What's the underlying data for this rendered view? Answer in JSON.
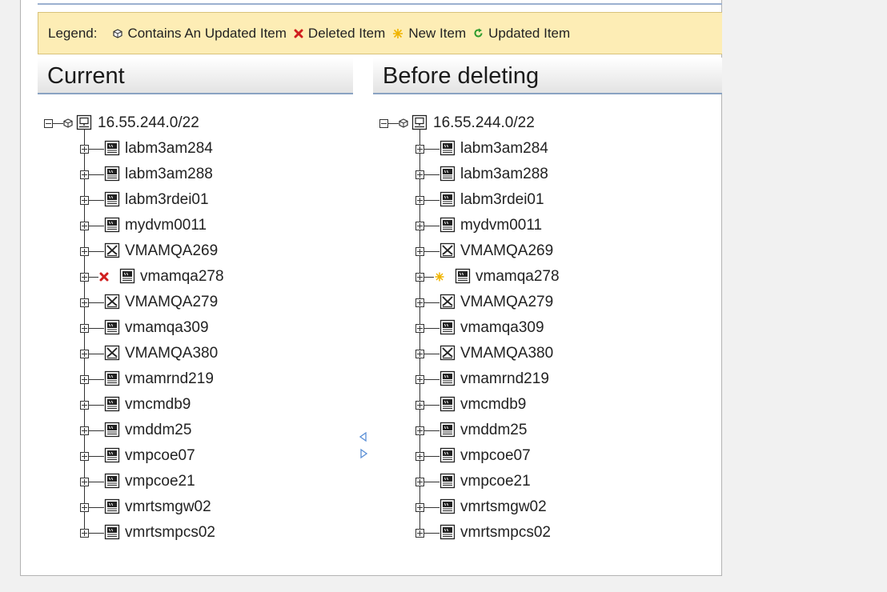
{
  "legend": {
    "title": "Legend:",
    "items": [
      {
        "label": "Contains An Updated Item",
        "icon": "contains-updated-icon"
      },
      {
        "label": "Deleted Item",
        "icon": "deleted-icon",
        "color": "#d01f1f"
      },
      {
        "label": "New Item",
        "icon": "new-icon",
        "color": "#f0b400"
      },
      {
        "label": "Updated Item",
        "icon": "updated-icon",
        "color": "#2e9b2e"
      }
    ]
  },
  "panes": {
    "left": {
      "title": "Current",
      "root": {
        "label": "16.55.244.0/22",
        "icon": "network-icon",
        "marker": "contains-updated"
      },
      "items": [
        {
          "label": "labm3am284",
          "icon": "server-icon",
          "marker": ""
        },
        {
          "label": "labm3am288",
          "icon": "server-icon",
          "marker": ""
        },
        {
          "label": "labm3rdei01",
          "icon": "server-icon",
          "marker": ""
        },
        {
          "label": "mydvm0011",
          "icon": "server-icon",
          "marker": ""
        },
        {
          "label": "VMAMQA269",
          "icon": "vmware-host-icon",
          "marker": ""
        },
        {
          "label": "vmamqa278",
          "icon": "server-icon",
          "marker": "deleted"
        },
        {
          "label": "VMAMQA279",
          "icon": "vmware-host-icon",
          "marker": ""
        },
        {
          "label": "vmamqa309",
          "icon": "server-icon",
          "marker": ""
        },
        {
          "label": "VMAMQA380",
          "icon": "vmware-host-icon",
          "marker": ""
        },
        {
          "label": "vmamrnd219",
          "icon": "server-icon",
          "marker": ""
        },
        {
          "label": "vmcmdb9",
          "icon": "server-icon",
          "marker": ""
        },
        {
          "label": "vmddm25",
          "icon": "server-icon",
          "marker": ""
        },
        {
          "label": "vmpcoe07",
          "icon": "server-icon",
          "marker": ""
        },
        {
          "label": "vmpcoe21",
          "icon": "server-icon",
          "marker": ""
        },
        {
          "label": "vmrtsmgw02",
          "icon": "server-icon",
          "marker": ""
        },
        {
          "label": "vmrtsmpcs02",
          "icon": "server-icon",
          "marker": ""
        }
      ]
    },
    "right": {
      "title": "Before deleting",
      "root": {
        "label": "16.55.244.0/22",
        "icon": "network-icon",
        "marker": "contains-updated"
      },
      "items": [
        {
          "label": "labm3am284",
          "icon": "server-icon",
          "marker": ""
        },
        {
          "label": "labm3am288",
          "icon": "server-icon",
          "marker": ""
        },
        {
          "label": "labm3rdei01",
          "icon": "server-icon",
          "marker": ""
        },
        {
          "label": "mydvm0011",
          "icon": "server-icon",
          "marker": ""
        },
        {
          "label": "VMAMQA269",
          "icon": "vmware-host-icon",
          "marker": ""
        },
        {
          "label": "vmamqa278",
          "icon": "server-icon",
          "marker": "new"
        },
        {
          "label": "VMAMQA279",
          "icon": "vmware-host-icon",
          "marker": ""
        },
        {
          "label": "vmamqa309",
          "icon": "server-icon",
          "marker": ""
        },
        {
          "label": "VMAMQA380",
          "icon": "vmware-host-icon",
          "marker": ""
        },
        {
          "label": "vmamrnd219",
          "icon": "server-icon",
          "marker": ""
        },
        {
          "label": "vmcmdb9",
          "icon": "server-icon",
          "marker": ""
        },
        {
          "label": "vmddm25",
          "icon": "server-icon",
          "marker": ""
        },
        {
          "label": "vmpcoe07",
          "icon": "server-icon",
          "marker": ""
        },
        {
          "label": "vmpcoe21",
          "icon": "server-icon",
          "marker": ""
        },
        {
          "label": "vmrtsmgw02",
          "icon": "server-icon",
          "marker": ""
        },
        {
          "label": "vmrtsmpcs02",
          "icon": "server-icon",
          "marker": ""
        }
      ]
    }
  },
  "colors": {
    "legend_bg": "#fdedb5",
    "header_border": "#8aa3c2",
    "splitter_arrow": "#5a8fd6"
  }
}
